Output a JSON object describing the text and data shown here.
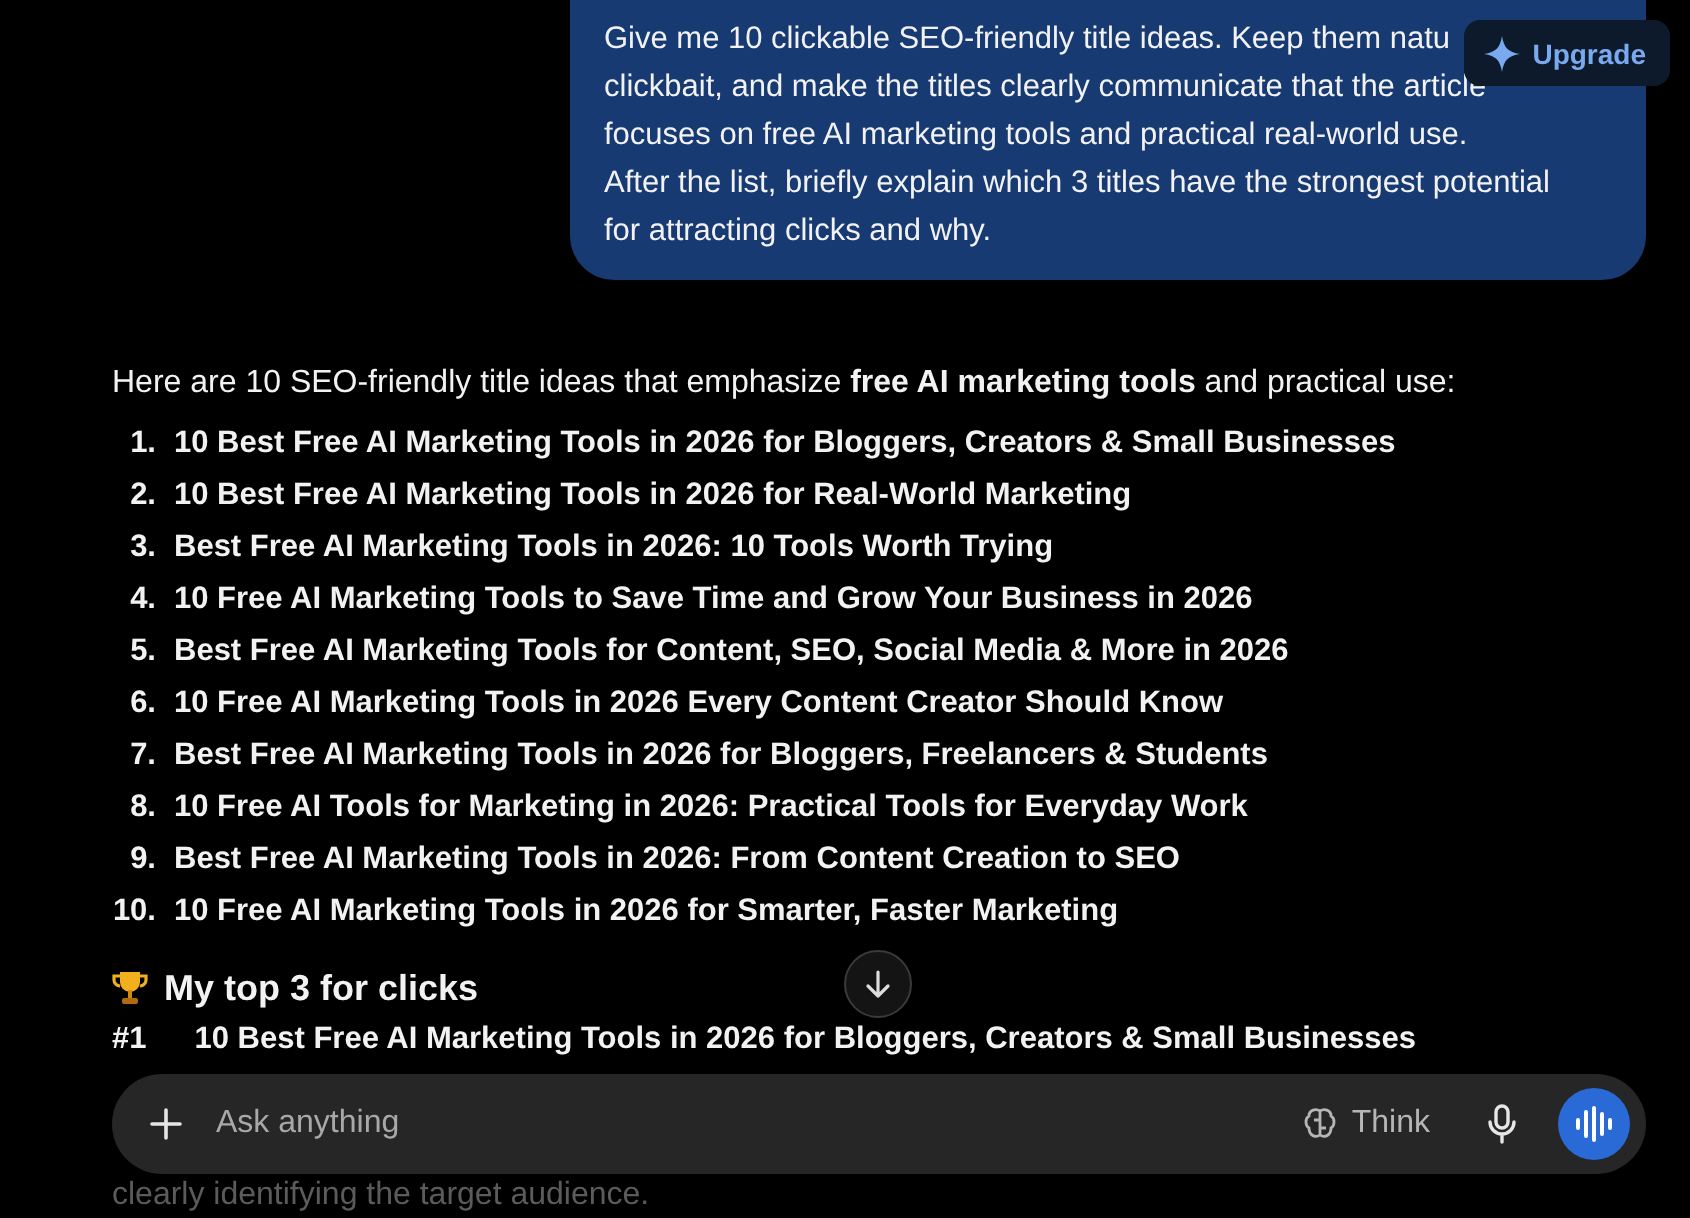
{
  "user_message": {
    "lines": [
      "Give me 10 clickable SEO-friendly title ideas. Keep them natu",
      "clickbait, and make the titles clearly communicate that the article",
      "focuses on free AI marketing tools and practical real-world use.",
      "After the list, briefly explain which 3 titles have the strongest potential",
      "for attracting clicks and why."
    ]
  },
  "upgrade_button": {
    "label": "Upgrade"
  },
  "response": {
    "intro": "Here are 10 SEO-friendly title ideas that emphasize **free AI marketing tools** and practical use:",
    "titles": [
      {
        "number": "1.",
        "text": "10 Best Free AI Marketing Tools in 2026 for Bloggers, Creators & Small Businesses"
      },
      {
        "number": "2.",
        "text": "10 Best Free AI Marketing Tools in 2026 for Real-World Marketing"
      },
      {
        "number": "3.",
        "text": "Best Free AI Marketing Tools in 2026: 10 Tools Worth Trying"
      },
      {
        "number": "4.",
        "text": "10 Free AI Marketing Tools to Save Time and Grow Your Business in 2026"
      },
      {
        "number": "5.",
        "text": "Best Free AI Marketing Tools for Content, SEO, Social Media & More in 2026"
      },
      {
        "number": "6.",
        "text": "10 Free AI Marketing Tools in 2026 Every Content Creator Should Know"
      },
      {
        "number": "7.",
        "text": "Best Free AI Marketing Tools in 2026 for Bloggers, Freelancers & Students"
      },
      {
        "number": "8.",
        "text": "10 Free AI Tools for Marketing in 2026: Practical Tools for Everyday Work"
      },
      {
        "number": "9.",
        "text": "Best Free AI Marketing Tools in 2026: From Content Creation to SEO"
      },
      {
        "number": "10.",
        "text": "10 Free AI Marketing Tools in 2026 for Smarter, Faster Marketing"
      }
    ],
    "heading": "My top 3 for clicks",
    "pick": {
      "rank": "#1",
      "text": "10 Best Free AI Marketing Tools in 2026 for Bloggers, Creators & Small Businesses"
    },
    "trailing_text": "clearly identifying the target audience."
  },
  "composer": {
    "placeholder": "Ask anything",
    "think_label": "Think"
  }
}
